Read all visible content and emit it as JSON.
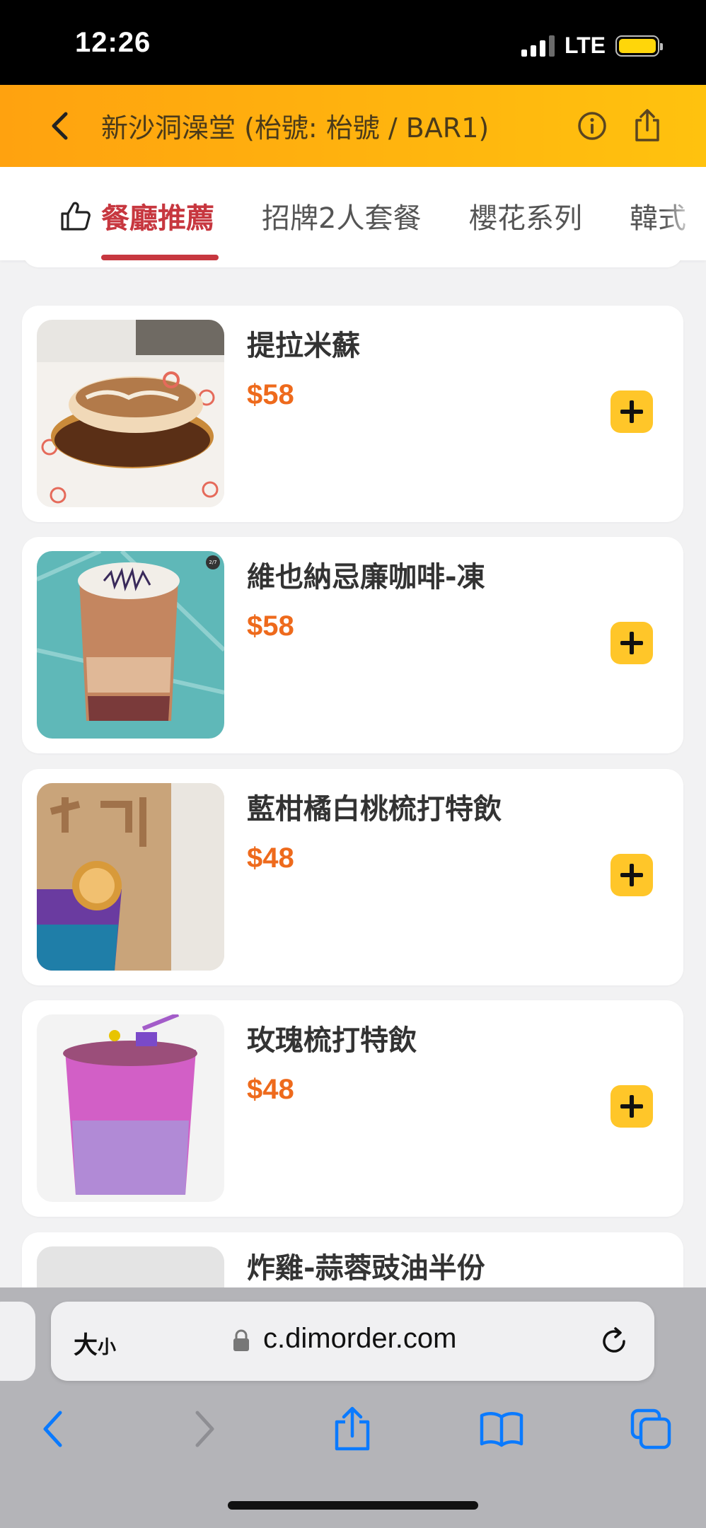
{
  "status_bar": {
    "time": "12:26",
    "network": "LTE"
  },
  "header": {
    "title": "新沙洞澡堂 (枱號: 枱號 / BAR1)",
    "back_icon": "chevron-left-icon",
    "info_icon": "info-icon",
    "share_icon": "share-icon"
  },
  "tabs": [
    {
      "label": "餐廳推薦",
      "active": true,
      "icon": "thumbs-up-icon"
    },
    {
      "label": "招牌2人套餐",
      "active": false
    },
    {
      "label": "櫻花系列",
      "active": false
    },
    {
      "label": "韓式",
      "active": false
    }
  ],
  "menu_items": [
    {
      "name": "提拉米蘇",
      "price": "$58"
    },
    {
      "name": "維也納忌廉咖啡-凍",
      "price": "$58"
    },
    {
      "name": "藍柑橘白桃梳打特飲",
      "price": "$48"
    },
    {
      "name": "玫瑰梳打特飲",
      "price": "$48"
    },
    {
      "name": "炸雞-蒜蓉豉油半份",
      "price": ""
    }
  ],
  "image_badge": "2/7",
  "browser": {
    "text_size_label": "大",
    "text_size_small": "小",
    "url": "c.dimorder.com"
  },
  "colors": {
    "header_start": "#ffa20f",
    "header_end": "#ffc20e",
    "active_tab": "#c7373f",
    "price": "#ee6a1c",
    "add_button": "#ffc629",
    "safari_blue": "#0a7aff"
  }
}
